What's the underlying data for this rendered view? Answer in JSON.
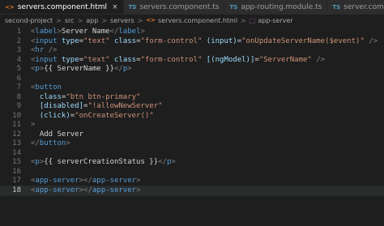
{
  "tabs": [
    {
      "icon": "<>",
      "kind": "html",
      "label": "servers.component.html",
      "active": true,
      "close": "×"
    },
    {
      "icon": "TS",
      "kind": "ts",
      "label": "servers.component.ts",
      "active": false
    },
    {
      "icon": "TS",
      "kind": "ts",
      "label": "app-routing.module.ts",
      "active": false
    },
    {
      "icon": "TS",
      "kind": "ts",
      "label": "server.component.ts",
      "active": false
    }
  ],
  "breadcrumb": {
    "parts": [
      "second-project",
      "src",
      "app",
      "servers"
    ],
    "file": "servers.component.html",
    "file_icon": "<>",
    "element": "app-server",
    "element_icon": "⬚",
    "separator": ">"
  },
  "lines": [
    {
      "n": "1",
      "tokens": [
        [
          "t",
          "<"
        ],
        [
          "tag",
          "label"
        ],
        [
          "t",
          ">"
        ],
        [
          "txt",
          "Server Name"
        ],
        [
          "t",
          "</"
        ],
        [
          "tag",
          "label"
        ],
        [
          "t",
          ">"
        ]
      ]
    },
    {
      "n": "2",
      "tokens": [
        [
          "t",
          "<"
        ],
        [
          "tag",
          "input"
        ],
        [
          "txt",
          " "
        ],
        [
          "attr",
          "type"
        ],
        [
          "txt",
          "="
        ],
        [
          "str",
          "\"text\""
        ],
        [
          "txt",
          " "
        ],
        [
          "attr",
          "class"
        ],
        [
          "txt",
          "="
        ],
        [
          "str",
          "\"form-control\""
        ],
        [
          "txt",
          " "
        ],
        [
          "attr",
          "(input)"
        ],
        [
          "txt",
          "="
        ],
        [
          "str",
          "\"onUpdateServerName($event)\""
        ],
        [
          "txt",
          " "
        ],
        [
          "t",
          "/>"
        ]
      ]
    },
    {
      "n": "3",
      "tokens": [
        [
          "t",
          "<"
        ],
        [
          "tag",
          "hr"
        ],
        [
          "txt",
          " "
        ],
        [
          "t",
          "/>"
        ]
      ]
    },
    {
      "n": "4",
      "tokens": [
        [
          "t",
          "<"
        ],
        [
          "tag",
          "input"
        ],
        [
          "txt",
          " "
        ],
        [
          "attr",
          "type"
        ],
        [
          "txt",
          "="
        ],
        [
          "str",
          "\"text\""
        ],
        [
          "txt",
          " "
        ],
        [
          "attr",
          "class"
        ],
        [
          "txt",
          "="
        ],
        [
          "str",
          "\"form-control\""
        ],
        [
          "txt",
          " "
        ],
        [
          "attr",
          "[(ngModel)]"
        ],
        [
          "txt",
          "="
        ],
        [
          "str",
          "\"ServerName\""
        ],
        [
          "txt",
          " "
        ],
        [
          "t",
          "/>"
        ]
      ]
    },
    {
      "n": "5",
      "tokens": [
        [
          "t",
          "<"
        ],
        [
          "tag",
          "p"
        ],
        [
          "t",
          ">"
        ],
        [
          "txt",
          "{{ ServerName }}"
        ],
        [
          "t",
          "</"
        ],
        [
          "tag",
          "p"
        ],
        [
          "t",
          ">"
        ]
      ]
    },
    {
      "n": "6",
      "tokens": []
    },
    {
      "n": "7",
      "tokens": [
        [
          "t",
          "<"
        ],
        [
          "tag",
          "button"
        ]
      ]
    },
    {
      "n": "8",
      "tokens": [
        [
          "txt",
          "  "
        ],
        [
          "attr",
          "class"
        ],
        [
          "txt",
          "="
        ],
        [
          "str",
          "\"btn btn-primary\""
        ]
      ]
    },
    {
      "n": "9",
      "tokens": [
        [
          "txt",
          "  "
        ],
        [
          "attr",
          "[disabled]"
        ],
        [
          "txt",
          "="
        ],
        [
          "str",
          "\"!allowNewServer\""
        ]
      ]
    },
    {
      "n": "10",
      "tokens": [
        [
          "txt",
          "  "
        ],
        [
          "attr",
          "(click)"
        ],
        [
          "txt",
          "="
        ],
        [
          "str",
          "\"onCreateServer()\""
        ]
      ]
    },
    {
      "n": "11",
      "tokens": [
        [
          "t",
          ">"
        ]
      ]
    },
    {
      "n": "12",
      "tokens": [
        [
          "txt",
          "  Add Server"
        ]
      ]
    },
    {
      "n": "13",
      "tokens": [
        [
          "t",
          "</"
        ],
        [
          "tag",
          "button"
        ],
        [
          "t",
          ">"
        ]
      ]
    },
    {
      "n": "14",
      "tokens": []
    },
    {
      "n": "15",
      "tokens": [
        [
          "t",
          "<"
        ],
        [
          "tag",
          "p"
        ],
        [
          "t",
          ">"
        ],
        [
          "txt",
          "{{ serverCreationStatus }}"
        ],
        [
          "t",
          "</"
        ],
        [
          "tag",
          "p"
        ],
        [
          "t",
          ">"
        ]
      ]
    },
    {
      "n": "16",
      "tokens": []
    },
    {
      "n": "17",
      "tokens": [
        [
          "t",
          "<"
        ],
        [
          "tag",
          "app-server"
        ],
        [
          "t",
          "></"
        ],
        [
          "tag",
          "app-server"
        ],
        [
          "t",
          ">"
        ]
      ]
    },
    {
      "n": "18",
      "tokens": [
        [
          "t",
          "<"
        ],
        [
          "tag",
          "app-server"
        ],
        [
          "t",
          "></"
        ],
        [
          "tag",
          "app-server"
        ],
        [
          "t",
          ">"
        ]
      ],
      "current": true
    }
  ],
  "colors": {
    "background": "#1e1e1e",
    "tag": "#569cd6",
    "attribute": "#9cdcfe",
    "string": "#ce9178",
    "punctuation": "#808080",
    "text": "#d4d4d4"
  }
}
